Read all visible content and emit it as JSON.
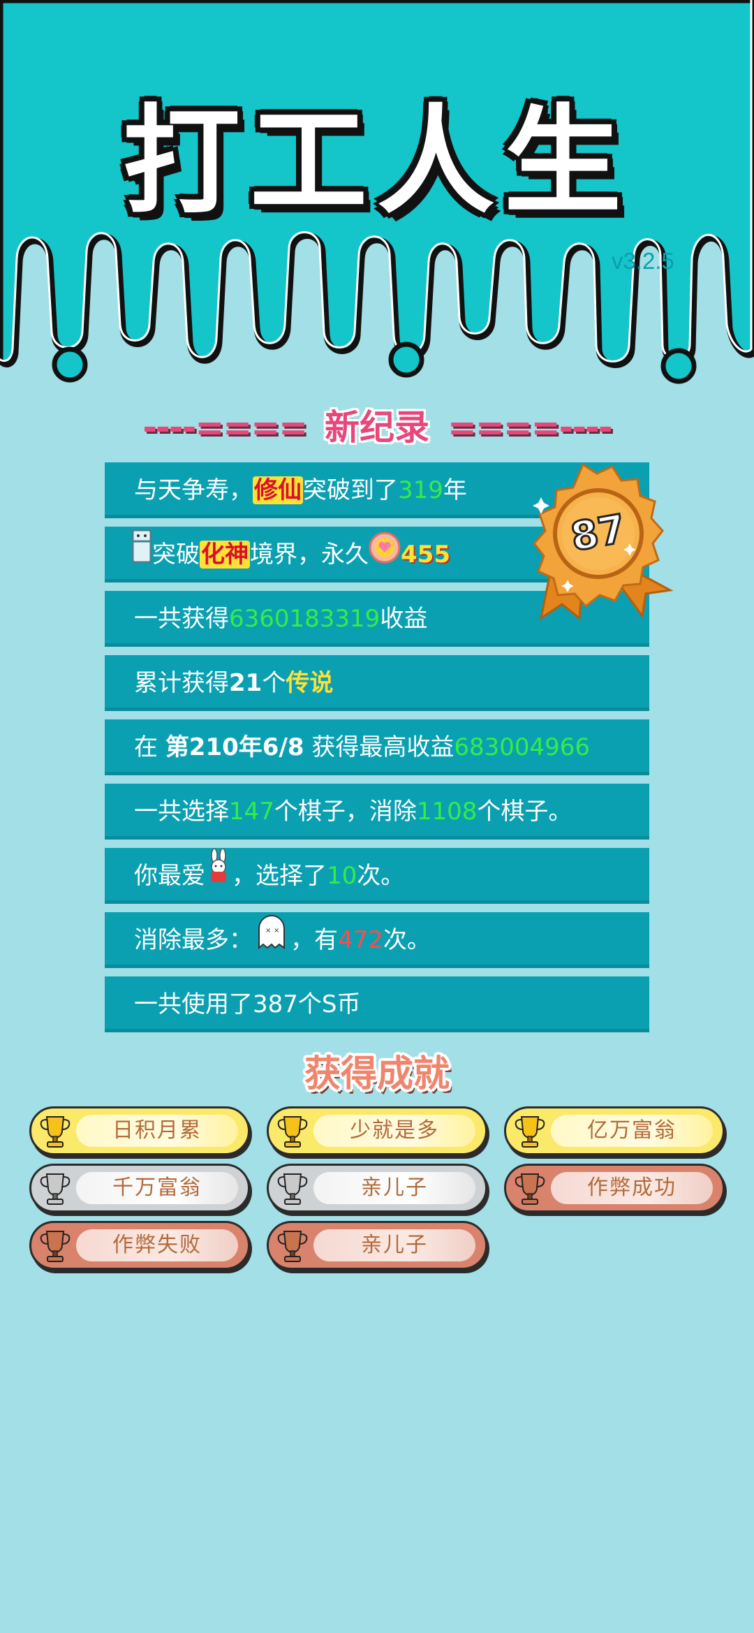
{
  "app": {
    "title": "打工人生",
    "version": "v3.2.5"
  },
  "record": {
    "dash_left": "----====",
    "label": "新纪录",
    "dash_right": "====----"
  },
  "rows": {
    "r1": {
      "a": "与天争寿，",
      "b": "修仙",
      "c": "突破到了",
      "d": "319",
      "e": "年"
    },
    "r2": {
      "a": "突破",
      "b": "化神",
      "c": "境界，永久",
      "d": "455"
    },
    "r3": {
      "a": "一共获得",
      "b": "6360183319",
      "c": "收益"
    },
    "r4": {
      "a": "累计获得",
      "b": "21",
      "c": "个",
      "d": "传说"
    },
    "r5": {
      "a": "在 ",
      "b": "第210年6/8",
      "c": " 获得最高收益",
      "d": "683004966"
    },
    "r6": {
      "a": "一共选择",
      "b": "147",
      "c": "个棋子，消除",
      "d": "1108",
      "e": "个棋子。"
    },
    "r7": {
      "a": "你最爱",
      "b": "，选择了",
      "c": "10",
      "d": "次。"
    },
    "r8": {
      "a": "消除最多：",
      "b": "，有",
      "c": "472",
      "d": "次。"
    },
    "r9": {
      "a": "一共使用了387个S币"
    }
  },
  "medal": {
    "value": "87"
  },
  "achievements": {
    "title": "获得成就",
    "items": [
      {
        "label": "日积月累",
        "tier": "gold"
      },
      {
        "label": "少就是多",
        "tier": "gold"
      },
      {
        "label": "亿万富翁",
        "tier": "gold"
      },
      {
        "label": "千万富翁",
        "tier": "silver"
      },
      {
        "label": "亲儿子",
        "tier": "silver"
      },
      {
        "label": "作弊成功",
        "tier": "bronze"
      },
      {
        "label": "作弊失败",
        "tier": "bronze"
      },
      {
        "label": "亲儿子",
        "tier": "bronze"
      }
    ]
  },
  "icons": {
    "fridge": "fridge-icon",
    "coin": "heart-coin-icon",
    "rabbit": "rabbit-icon",
    "ghost": "ghost-icon",
    "trophy": "trophy-icon",
    "medal": "medal-badge-icon"
  },
  "colors": {
    "header_bg": "#14c5c9",
    "page_bg": "#a2dfe6",
    "row_bg": "#0aa0b2",
    "green": "#33ee44",
    "yellow": "#ffe135",
    "red": "#ff4b4b",
    "pink": "#e7477a"
  }
}
